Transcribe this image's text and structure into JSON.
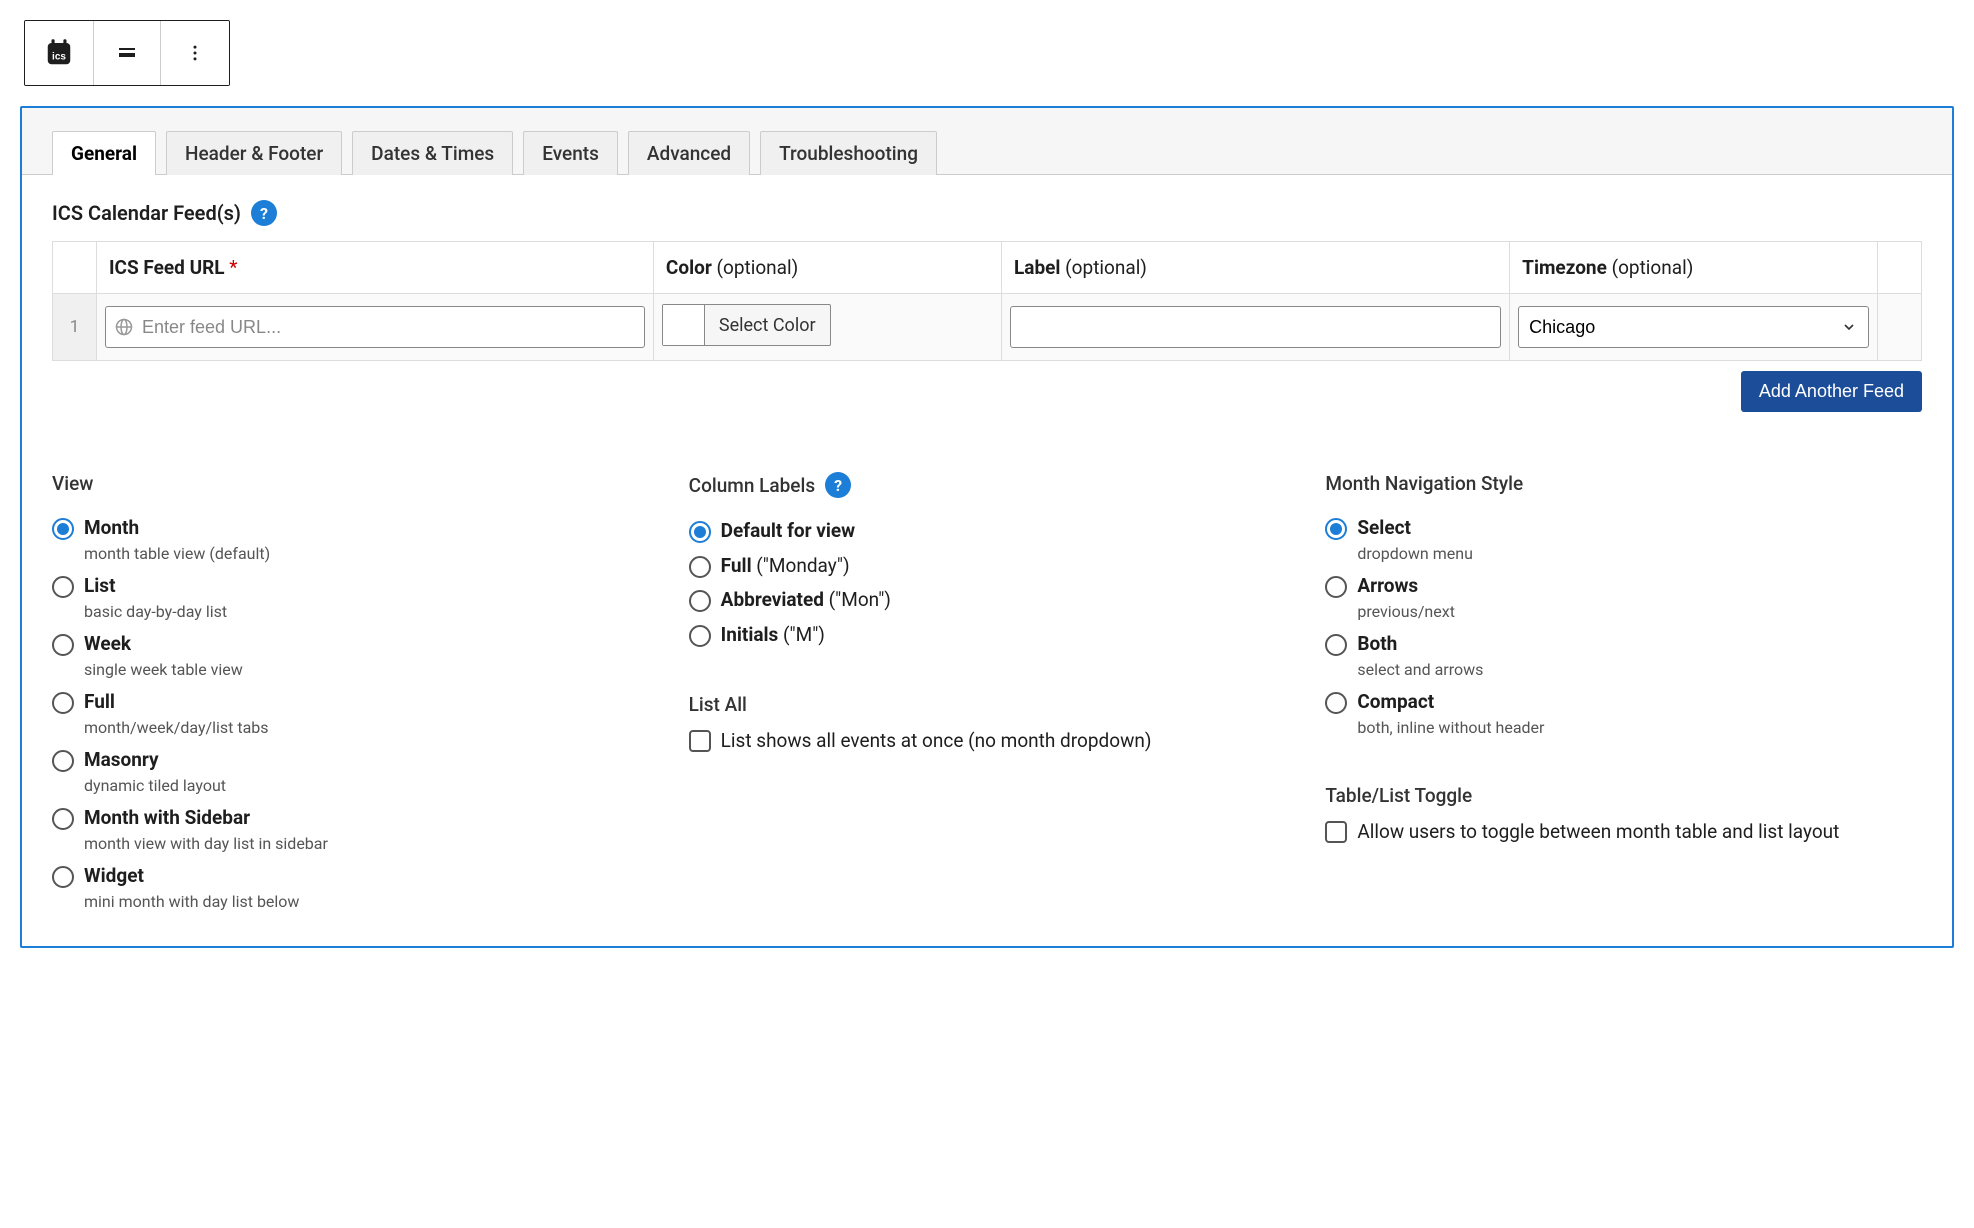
{
  "toolbar": {
    "ics_icon": "ics",
    "align_icon": "align",
    "more_icon": "more"
  },
  "tabs": [
    {
      "label": "General",
      "active": true
    },
    {
      "label": "Header & Footer",
      "active": false
    },
    {
      "label": "Dates & Times",
      "active": false
    },
    {
      "label": "Events",
      "active": false
    },
    {
      "label": "Advanced",
      "active": false
    },
    {
      "label": "Troubleshooting",
      "active": false
    }
  ],
  "feeds": {
    "section_title": "ICS Calendar Feed(s)",
    "headers": {
      "url_bold": "ICS Feed URL",
      "url_required": "*",
      "color_bold": "Color",
      "color_opt": " (optional)",
      "label_bold": "Label",
      "label_opt": " (optional)",
      "tz_bold": "Timezone",
      "tz_opt": " (optional)"
    },
    "row": {
      "index": "1",
      "url_placeholder": "Enter feed URL...",
      "color_button": "Select Color",
      "tz_value": "Chicago"
    },
    "add_button": "Add Another Feed"
  },
  "view": {
    "title": "View",
    "options": [
      {
        "label": "Month",
        "desc": "month table view (default)",
        "selected": true
      },
      {
        "label": "List",
        "desc": "basic day-by-day list",
        "selected": false
      },
      {
        "label": "Week",
        "desc": "single week table view",
        "selected": false
      },
      {
        "label": "Full",
        "desc": "month/week/day/list tabs",
        "selected": false
      },
      {
        "label": "Masonry",
        "desc": "dynamic tiled layout",
        "selected": false
      },
      {
        "label": "Month with Sidebar",
        "desc": "month view with day list in sidebar",
        "selected": false
      },
      {
        "label": "Widget",
        "desc": "mini month with day list below",
        "selected": false
      }
    ]
  },
  "columnLabels": {
    "title": "Column Labels",
    "options": [
      {
        "label": "Default for view",
        "extra": "",
        "selected": true
      },
      {
        "label": "Full",
        "extra": " (\"Monday\")",
        "selected": false
      },
      {
        "label": "Abbreviated",
        "extra": " (\"Mon\")",
        "selected": false
      },
      {
        "label": "Initials",
        "extra": " (\"M\")",
        "selected": false
      }
    ]
  },
  "listAll": {
    "title": "List All",
    "checkbox_label": "List shows all events at once (no month dropdown)"
  },
  "monthNav": {
    "title": "Month Navigation Style",
    "options": [
      {
        "label": "Select",
        "desc": "dropdown menu",
        "selected": true
      },
      {
        "label": "Arrows",
        "desc": "previous/next",
        "selected": false
      },
      {
        "label": "Both",
        "desc": "select and arrows",
        "selected": false
      },
      {
        "label": "Compact",
        "desc": "both, inline without header",
        "selected": false
      }
    ]
  },
  "tableToggle": {
    "title": "Table/List Toggle",
    "checkbox_label": "Allow users to toggle between month table and list layout"
  }
}
